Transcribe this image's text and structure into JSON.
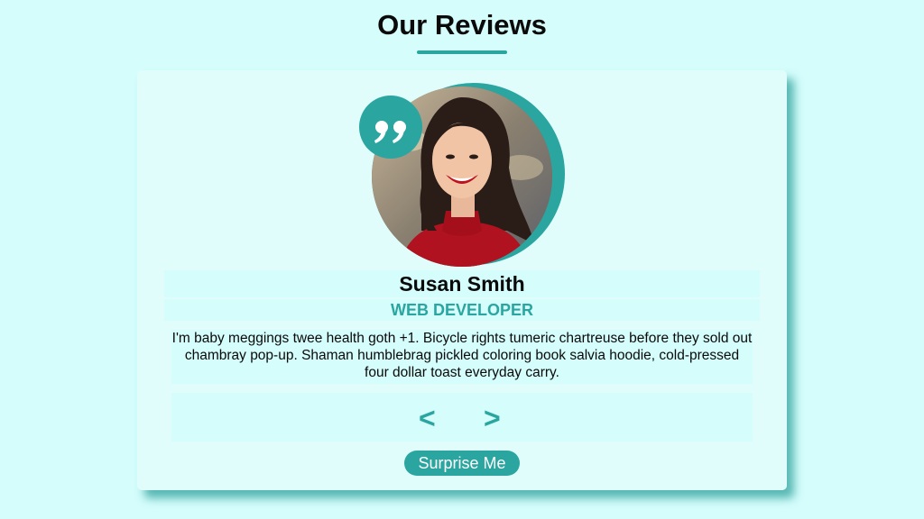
{
  "header": {
    "title": "Our Reviews"
  },
  "review": {
    "name": "Susan Smith",
    "job": "WEB DEVELOPER",
    "text": "I'm baby meggings twee health goth +1. Bicycle rights tumeric chartreuse before they sold out chambray pop-up. Shaman humblebrag pickled coloring book salvia hoodie, cold-pressed four dollar toast everyday carry.",
    "avatar": "portrait-photo",
    "quote_icon": "quote-icon"
  },
  "nav": {
    "prev_label": "<",
    "next_label": ">"
  },
  "actions": {
    "surprise_label": "Surprise Me"
  },
  "colors": {
    "background": "#d4fdfc",
    "card": "#e0fdfc",
    "accent": "#2aa5a0",
    "text": "#0a0a0a"
  }
}
